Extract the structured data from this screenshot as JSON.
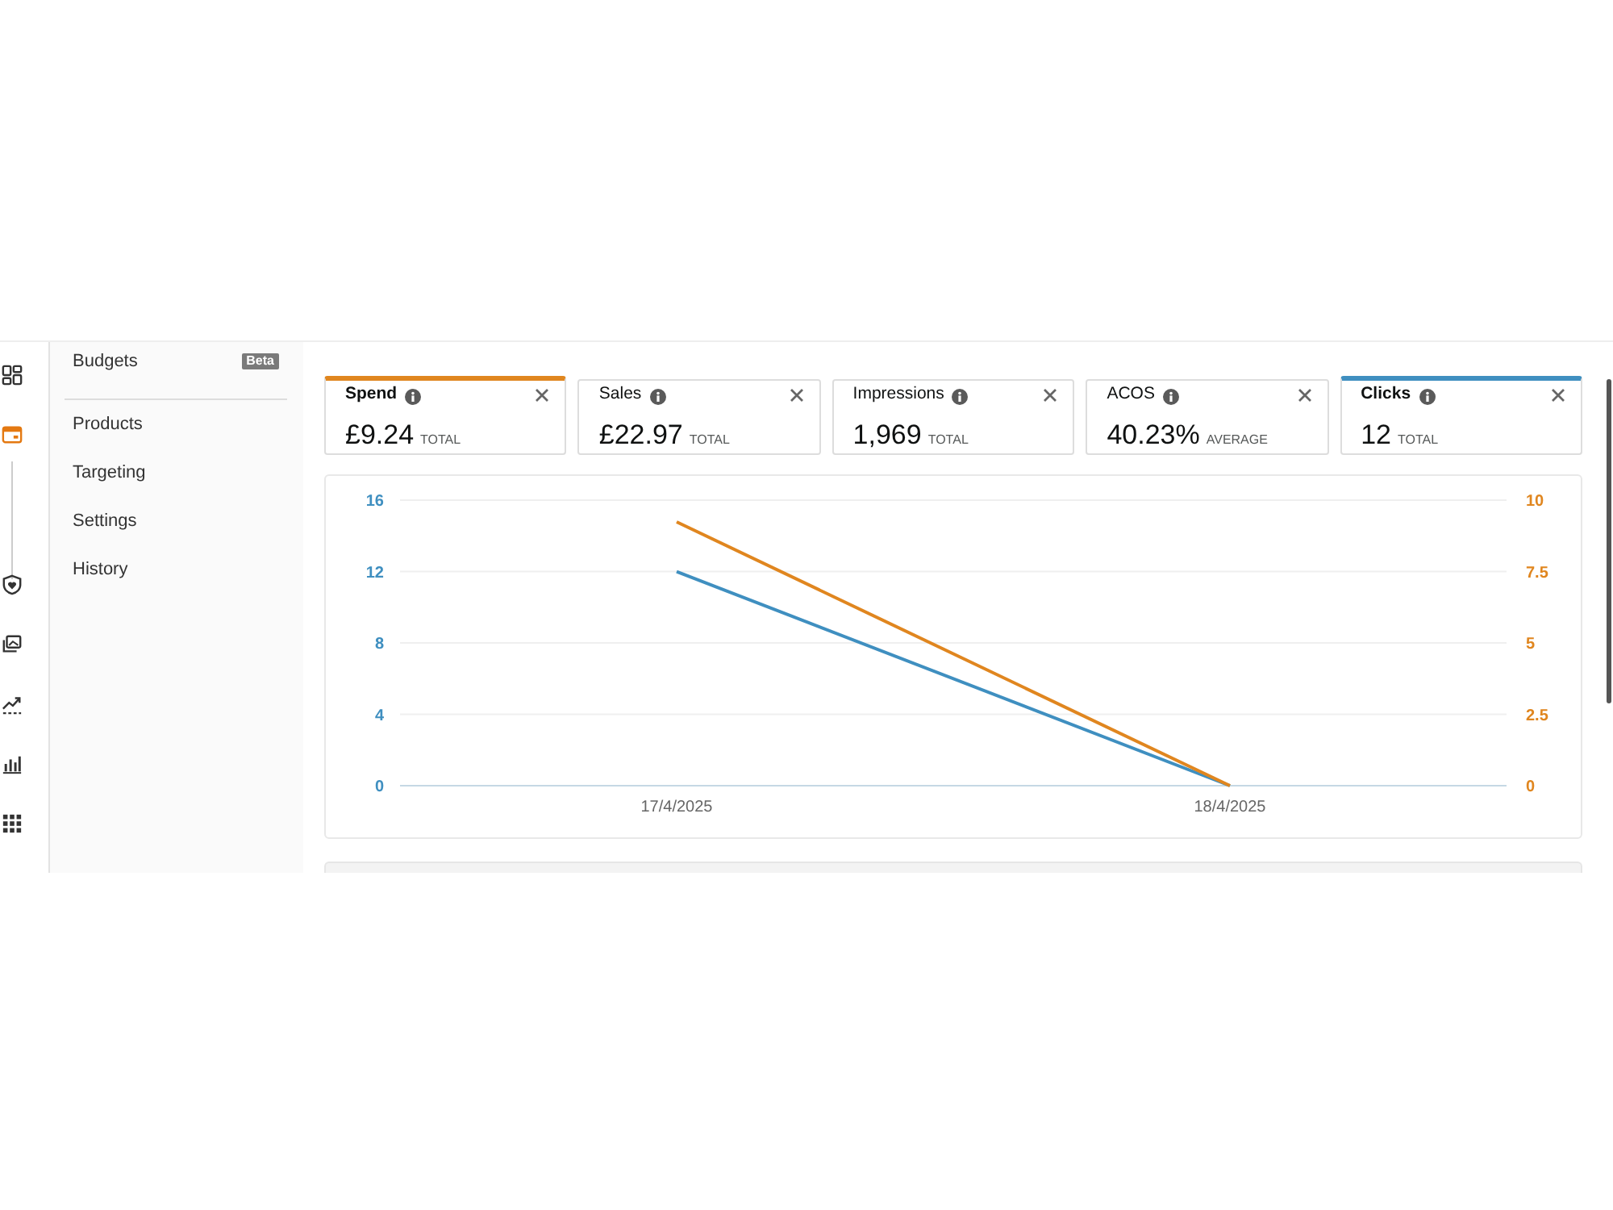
{
  "rail": [
    {
      "selected": false
    },
    {
      "selected": true
    },
    {
      "selected": false
    },
    {
      "selected": false
    },
    {
      "selected": false
    },
    {
      "selected": false
    },
    {
      "selected": false
    }
  ],
  "sidebar": {
    "header": {
      "label": "Budgets",
      "badge": "Beta"
    },
    "items": [
      {
        "label": "Products"
      },
      {
        "label": "Targeting"
      },
      {
        "label": "Settings"
      },
      {
        "label": "History"
      }
    ]
  },
  "metrics": [
    {
      "label": "Spend",
      "value": "£9.24",
      "unit": "TOTAL",
      "selected": true,
      "color": "#e0861f"
    },
    {
      "label": "Sales",
      "value": "£22.97",
      "unit": "TOTAL",
      "selected": false
    },
    {
      "label": "Impressions",
      "value": "1,969",
      "unit": "TOTAL",
      "selected": false
    },
    {
      "label": "ACOS",
      "value": "40.23%",
      "unit": "AVERAGE",
      "selected": false
    },
    {
      "label": "Clicks",
      "value": "12",
      "unit": "TOTAL",
      "selected": true,
      "color": "#3f8fc0"
    }
  ],
  "chart": {
    "chart_data": [
      {
        "type": "line",
        "categories": [
          "17/4/2025",
          "18/4/2025"
        ],
        "ylim": [
          0,
          16
        ],
        "yticks": [
          0,
          4,
          8,
          12,
          16
        ],
        "y2lim": [
          0,
          10
        ],
        "y2ticks": [
          0,
          2.5,
          5,
          7.5,
          10
        ],
        "grid": true,
        "series": [
          {
            "color": "#3f8fc0",
            "values": [
              12,
              0
            ]
          },
          {
            "color": "#e0861f",
            "values": [
              9.24,
              0
            ],
            "axis": "y2"
          }
        ]
      }
    ]
  }
}
